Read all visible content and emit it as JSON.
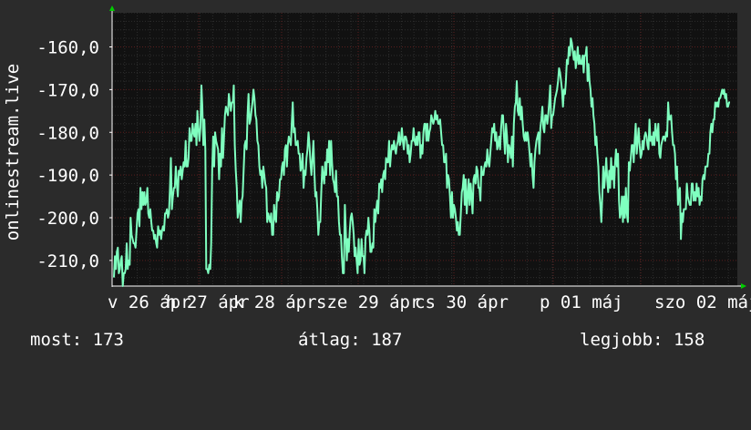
{
  "chart_data": {
    "type": "line",
    "ylabel": "onlinestream.live",
    "y_ticks": [
      "-160,0",
      "-170,0",
      "-180,0",
      "-190,0",
      "-200,0",
      "-210,0"
    ],
    "y_tick_values": [
      -160,
      -170,
      -180,
      -190,
      -200,
      -210
    ],
    "ylim": [
      -216,
      -152
    ],
    "x_tick_labels": [
      "v 26 ápr",
      "h 27 ápr",
      "k 28 ápr",
      "sze 29 ápr",
      "cs 30 ápr",
      "p 01 máj",
      "szo 02 máj"
    ],
    "series": [
      {
        "color": "#7fffbf",
        "values": [
          -214,
          -209,
          -212,
          -208,
          -207,
          -213,
          -212,
          -210,
          -209,
          -216,
          -213,
          -213,
          -212,
          -206,
          -212,
          -210,
          -211,
          -200,
          -204,
          -205,
          -206,
          -206,
          -207,
          -203,
          -199,
          -198,
          -202,
          -193,
          -198,
          -194,
          -197,
          -194,
          -197,
          -196,
          -193,
          -199,
          -200,
          -198,
          -201,
          -203,
          -203,
          -205,
          -204,
          -206,
          -207,
          -202,
          -204,
          -203,
          -205,
          -203,
          -202,
          -203,
          -199,
          -199,
          -198,
          -200,
          -199,
          -193,
          -186,
          -198,
          -195,
          -193,
          -193,
          -188,
          -192,
          -195,
          -189,
          -190,
          -188,
          -191,
          -189,
          -187,
          -188,
          -182,
          -188,
          -188,
          -186,
          -179,
          -182,
          -182,
          -178,
          -180,
          -181,
          -178,
          -183,
          -175,
          -179,
          -182,
          -179,
          -169,
          -174,
          -183,
          -177,
          -184,
          -212,
          -212,
          -213,
          -211,
          -212,
          -206,
          -189,
          -181,
          -188,
          -180,
          -182,
          -183,
          -184,
          -191,
          -185,
          -188,
          -179,
          -186,
          -181,
          -176,
          -174,
          -175,
          -176,
          -171,
          -173,
          -175,
          -173,
          -173,
          -169,
          -183,
          -189,
          -193,
          -200,
          -198,
          -196,
          -201,
          -196,
          -195,
          -189,
          -183,
          -182,
          -184,
          -176,
          -171,
          -178,
          -177,
          -175,
          -173,
          -170,
          -172,
          -176,
          -177,
          -182,
          -183,
          -188,
          -190,
          -189,
          -193,
          -188,
          -190,
          -192,
          -193,
          -201,
          -199,
          -200,
          -201,
          -199,
          -204,
          -204,
          -197,
          -200,
          -201,
          -194,
          -196,
          -195,
          -191,
          -191,
          -188,
          -187,
          -190,
          -184,
          -183,
          -188,
          -183,
          -181,
          -182,
          -183,
          -178,
          -173,
          -180,
          -179,
          -183,
          -183,
          -182,
          -185,
          -185,
          -189,
          -188,
          -185,
          -193,
          -189,
          -190,
          -186,
          -184,
          -180,
          -183,
          -187,
          -190,
          -186,
          -182,
          -189,
          -195,
          -194,
          -198,
          -204,
          -201,
          -201,
          -194,
          -188,
          -190,
          -192,
          -187,
          -190,
          -184,
          -187,
          -182,
          -190,
          -182,
          -187,
          -191,
          -192,
          -194,
          -189,
          -195,
          -195,
          -201,
          -204,
          -204,
          -209,
          -213,
          -213,
          -197,
          -203,
          -210,
          -205,
          -208,
          -203,
          -200,
          -199,
          -201,
          -204,
          -209,
          -207,
          -210,
          -213,
          -205,
          -211,
          -210,
          -205,
          -209,
          -209,
          -213,
          -205,
          -203,
          -204,
          -200,
          -203,
          -208,
          -208,
          -206,
          -207,
          -198,
          -201,
          -198,
          -196,
          -199,
          -192,
          -193,
          -191,
          -194,
          -190,
          -189,
          -191,
          -186,
          -187,
          -187,
          -182,
          -188,
          -185,
          -183,
          -184,
          -182,
          -184,
          -185,
          -183,
          -182,
          -180,
          -183,
          -182,
          -179,
          -182,
          -184,
          -181,
          -181,
          -182,
          -185,
          -183,
          -187,
          -185,
          -182,
          -182,
          -179,
          -182,
          -183,
          -181,
          -183,
          -180,
          -180,
          -186,
          -183,
          -185,
          -180,
          -178,
          -178,
          -182,
          -178,
          -182,
          -180,
          -179,
          -176,
          -177,
          -178,
          -177,
          -175,
          -177,
          -176,
          -178,
          -178,
          -177,
          -180,
          -183,
          -183,
          -187,
          -187,
          -185,
          -193,
          -190,
          -191,
          -195,
          -200,
          -194,
          -200,
          -197,
          -198,
          -200,
          -203,
          -201,
          -204,
          -204,
          -199,
          -194,
          -193,
          -190,
          -197,
          -191,
          -199,
          -195,
          -191,
          -197,
          -192,
          -195,
          -199,
          -191,
          -190,
          -192,
          -188,
          -189,
          -193,
          -193,
          -196,
          -188,
          -190,
          -190,
          -188,
          -187,
          -188,
          -184,
          -187,
          -188,
          -185,
          -182,
          -179,
          -180,
          -178,
          -182,
          -180,
          -184,
          -183,
          -181,
          -184,
          -179,
          -176,
          -176,
          -181,
          -185,
          -178,
          -181,
          -187,
          -183,
          -184,
          -186,
          -181,
          -188,
          -178,
          -174,
          -173,
          -168,
          -175,
          -176,
          -172,
          -177,
          -174,
          -178,
          -181,
          -182,
          -180,
          -182,
          -180,
          -182,
          -185,
          -188,
          -185,
          -190,
          -193,
          -187,
          -184,
          -182,
          -181,
          -180,
          -185,
          -179,
          -177,
          -174,
          -179,
          -180,
          -176,
          -176,
          -178,
          -176,
          -173,
          -169,
          -179,
          -176,
          -176,
          -174,
          -172,
          -171,
          -170,
          -168,
          -165,
          -166,
          -168,
          -170,
          -174,
          -170,
          -171,
          -168,
          -163,
          -164,
          -160,
          -162,
          -158,
          -159,
          -161,
          -163,
          -161,
          -165,
          -163,
          -160,
          -164,
          -162,
          -164,
          -164,
          -162,
          -166,
          -162,
          -162,
          -160,
          -168,
          -164,
          -168,
          -170,
          -174,
          -172,
          -176,
          -178,
          -183,
          -181,
          -185,
          -188,
          -194,
          -197,
          -201,
          -195,
          -188,
          -193,
          -190,
          -186,
          -191,
          -194,
          -189,
          -193,
          -186,
          -191,
          -188,
          -193,
          -187,
          -184,
          -188,
          -185,
          -196,
          -200,
          -199,
          -195,
          -201,
          -195,
          -200,
          -193,
          -199,
          -201,
          -187,
          -189,
          -186,
          -183,
          -183,
          -187,
          -182,
          -178,
          -185,
          -182,
          -179,
          -183,
          -186,
          -185,
          -182,
          -184,
          -181,
          -180,
          -181,
          -183,
          -184,
          -177,
          -182,
          -181,
          -183,
          -180,
          -183,
          -178,
          -180,
          -182,
          -178,
          -185,
          -186,
          -183,
          -182,
          -181,
          -181,
          -182,
          -180,
          -181,
          -173,
          -177,
          -177,
          -176,
          -180,
          -183,
          -183,
          -185,
          -191,
          -188,
          -197,
          -194,
          -193,
          -205,
          -199,
          -201,
          -198,
          -198,
          -198,
          -192,
          -195,
          -196,
          -197,
          -197,
          -192,
          -192,
          -196,
          -194,
          -196,
          -192,
          -195,
          -193,
          -197,
          -195,
          -196,
          -191,
          -190,
          -191,
          -188,
          -188,
          -188,
          -185,
          -185,
          -180,
          -178,
          -180,
          -177,
          -177,
          -173,
          -174,
          -173,
          -174,
          -172,
          -172,
          -171,
          -170,
          -171,
          -170,
          -172,
          -171,
          -174,
          -174,
          -173,
          -173
        ]
      }
    ],
    "grid": true,
    "legend": "none"
  },
  "stats": {
    "current": "most: 173",
    "average": "átlag: 187",
    "best": "legjobb: 158"
  },
  "colors": {
    "background": "#2b2b2b",
    "plot_background": "#111111",
    "line": "#7fffbf",
    "grid_major": "#5a1e1e",
    "grid_minor": "#2e2e2e",
    "axis": "#ffffff",
    "arrow": "#00cc00"
  }
}
